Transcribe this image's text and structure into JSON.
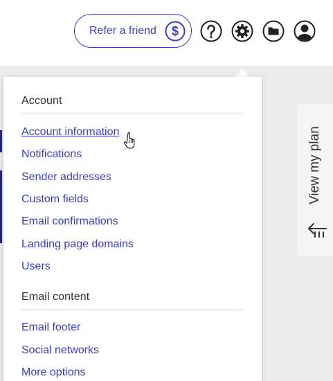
{
  "header": {
    "refer_label": "Refer a friend",
    "icons": [
      "dollar-icon",
      "help-icon",
      "settings-icon",
      "folder-icon",
      "account-icon"
    ]
  },
  "menu": {
    "sections": [
      {
        "title": "Account",
        "items": [
          "Account information",
          "Notifications",
          "Sender addresses",
          "Custom fields",
          "Email confirmations",
          "Landing page domains",
          "Users"
        ]
      },
      {
        "title": "Email content",
        "items": [
          "Email footer",
          "Social networks",
          "More options"
        ]
      }
    ]
  },
  "side_tab": {
    "label": "View my plan",
    "icon": "collapse-left-icon"
  },
  "colors": {
    "accent": "#3b3dbf",
    "text": "#2d2d2d",
    "background": "#ebebeb",
    "nav_strip": "#23237a"
  }
}
